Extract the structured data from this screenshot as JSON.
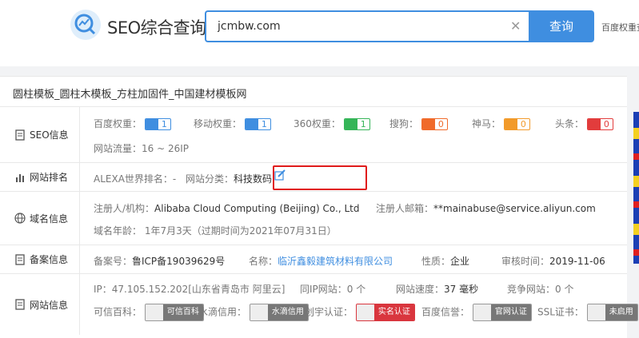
{
  "header": {
    "logo_text": "SEO综合查询",
    "search_value": "jcmbw.com",
    "search_button": "查询",
    "weight_link": "百度权重查"
  },
  "site_title": "圆柱模板_圆柱木模板_方柱加固件_中国建材模板网",
  "seo": {
    "label": "SEO信息",
    "baidu_label": "百度权重：",
    "baidu_value": "1",
    "mobile_label": "移动权重：",
    "mobile_value": "1",
    "s360_label": "360权重：",
    "s360_value": "1",
    "sogou_label": "搜狗：",
    "sogou_value": "0",
    "shenma_label": "神马：",
    "shenma_value": "0",
    "toutiao_label": "头条：",
    "toutiao_value": "0",
    "traffic": "网站流量：16 ~ 26IP"
  },
  "rank": {
    "label": "网站排名",
    "alexa": "ALEXA世界排名：-",
    "category_label": "网站分类：",
    "category_value": "科技数码"
  },
  "domain": {
    "label": "域名信息",
    "registrant_label": "注册人/机构：",
    "registrant_value": "Alibaba Cloud Computing (Beijing) Co., Ltd",
    "email_label": "注册人邮箱：",
    "email_value": "**mainabuse@service.aliyun.com",
    "age": "域名年龄： 1年7月3天（过期时间为2021年07月31日）"
  },
  "beian": {
    "label": "备案信息",
    "number_label": "备案号：",
    "number_value": "鲁ICP备19039629号",
    "name_label": "名称：",
    "name_value": "临沂鑫毅建筑材料有限公司",
    "nature_label": "性质：",
    "nature_value": "企业",
    "audit_label": "审核时间：",
    "audit_value": "2019-11-06"
  },
  "site": {
    "label": "网站信息",
    "ip": "IP：47.105.152.202[山东省青岛市 阿里云]",
    "same_ip": "同IP网站：0 个",
    "speed_label": "网站速度：",
    "speed_value": "37 毫秒",
    "compete": "竞争网站：0 个",
    "kexin_label": "可信百科：",
    "kexin_badge": "可信百科",
    "shuidi_label": "水滴信用：",
    "shuidi_badge": "水滴信用",
    "chuangyu_label": "创宇认证：",
    "chuangyu_badge": "实名认证",
    "baidu_xin_label": "百度信誉：",
    "baidu_xin_badge": "官网认证",
    "ssl_label": "SSL证书：",
    "ssl_badge": "未启用"
  },
  "colors": {
    "accent": "#3f8ee0",
    "highlight_box": "#e01b1b"
  }
}
